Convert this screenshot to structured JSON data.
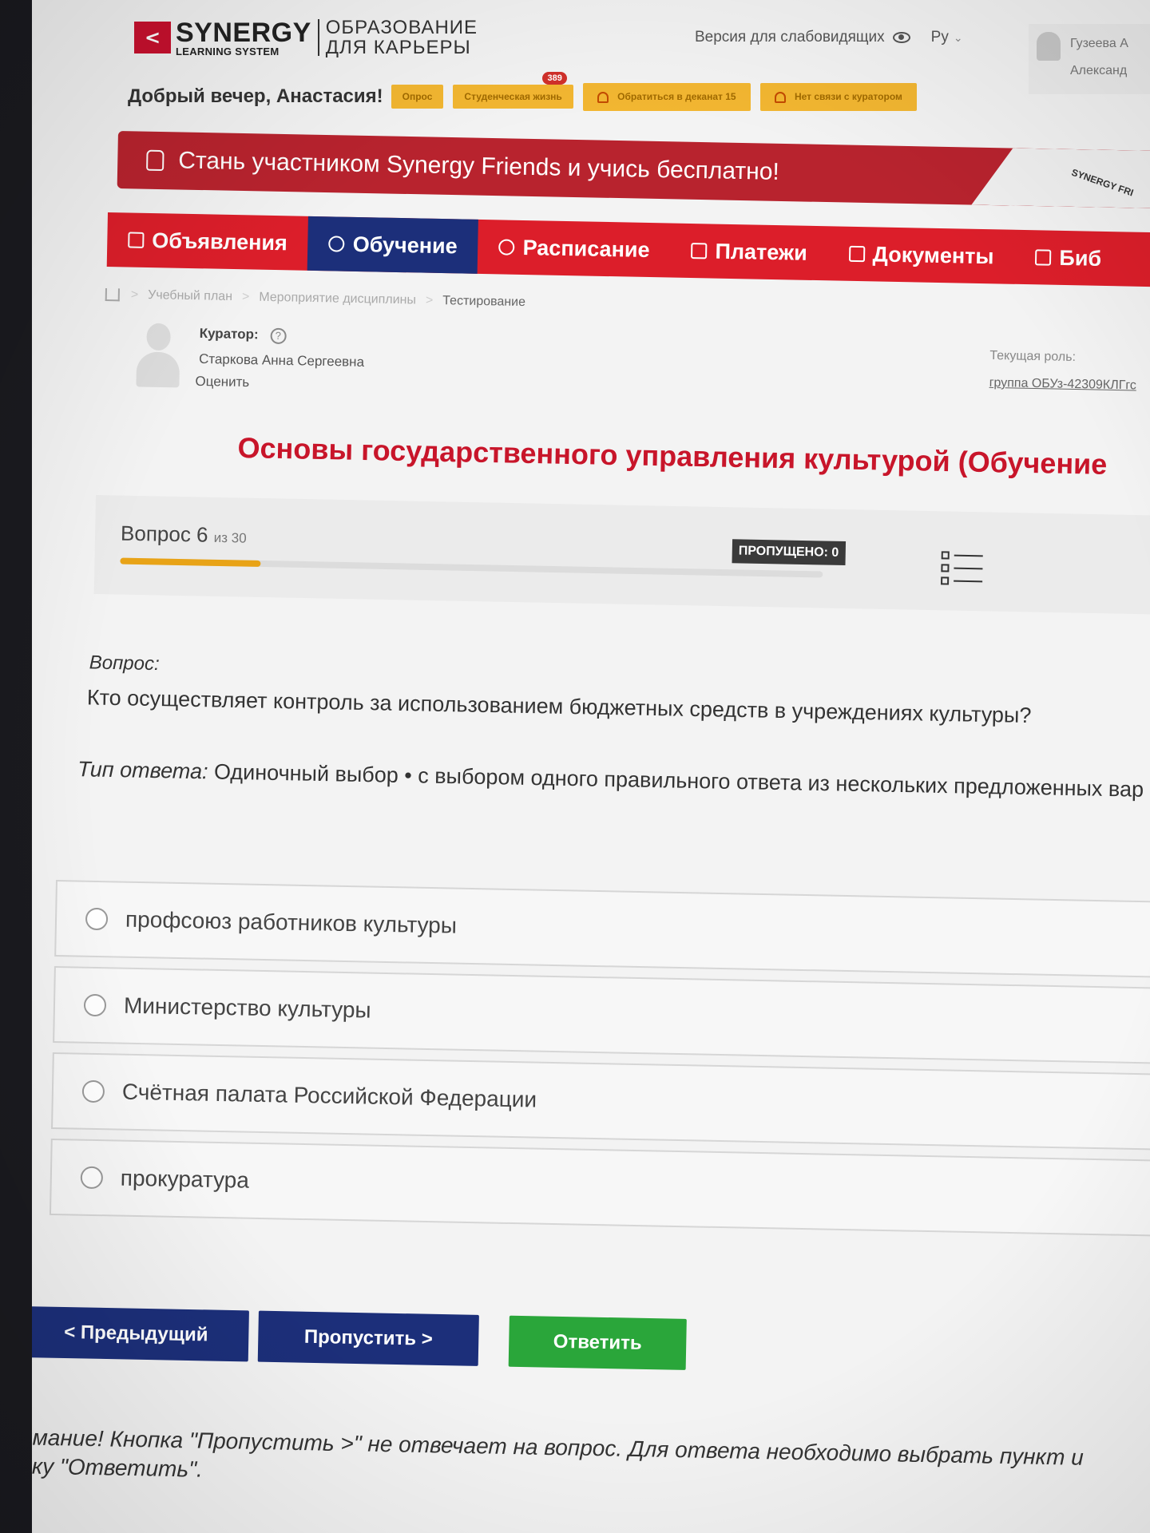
{
  "header": {
    "logo_main": "SYNERGY",
    "logo_sub": "LEARNING SYSTEM",
    "logo_right_line1": "ОБРАЗОВАНИЕ",
    "logo_right_line2": "ДЛЯ КАРЬЕРЫ",
    "accessibility_label": "Версия для слабовидящих",
    "language": "Ру",
    "user_name_line1": "Гузеева А",
    "user_name_line2": "Александ"
  },
  "greeting": {
    "text": "Добрый вечер, Анастасия!",
    "pills": {
      "survey": "Опрос",
      "student_life": "Студенческая жизнь",
      "student_life_badge": "389",
      "dean": "Обратиться в деканат 15",
      "curator": "Нет связи с куратором"
    }
  },
  "promo": {
    "text": "Стань участником Synergy Friends и учись бесплатно!",
    "deco": "SYNERGY FRI"
  },
  "nav": {
    "announcements": "Объявления",
    "learning": "Обучение",
    "schedule": "Расписание",
    "payments": "Платежи",
    "documents": "Документы",
    "library": "Биб"
  },
  "breadcrumbs": [
    "Учебный план",
    "Мероприятие дисциплины",
    "Тестирование"
  ],
  "curator": {
    "label": "Куратор:",
    "name": "Старкова Анна Сергеевна",
    "rate": "Оценить",
    "role_label": "Текущая роль:",
    "role_value": "группа ОБУз-42309КЛГгс"
  },
  "course_title": "Основы государственного управления культурой (Обучение",
  "progress": {
    "question_label": "Вопрос 6",
    "of_total": "из 30",
    "current": 6,
    "total": 30,
    "skipped": "ПРОПУЩЕНО: 0"
  },
  "question": {
    "label": "Вопрос:",
    "text": "Кто осуществляет контроль за использованием бюджетных средств в учреждениях культуры?",
    "answer_type_label": "Тип ответа:",
    "answer_type_value": "Одиночный выбор • с выбором одного правильного ответа из нескольких предложенных вар"
  },
  "options": [
    {
      "label": "профсоюз работников культуры"
    },
    {
      "label": "Министерство культуры"
    },
    {
      "label": "Счётная палата Российской Федерации"
    },
    {
      "label": "прокуратура"
    }
  ],
  "buttons": {
    "prev": "< Предыдущий",
    "skip": "Пропустить >",
    "answer": "Ответить"
  },
  "notice": {
    "line1": "нимание! Кнопка \"Пропустить >\" не отвечает на вопрос. Для ответа необходимо выбрать пункт и",
    "line2": "опку \"Ответить\"."
  },
  "colors": {
    "brand_red": "#dc1e2a",
    "active_nav": "#1c2f7a",
    "progress_fill": "#e8a317",
    "answer_green": "#2aa63a"
  }
}
